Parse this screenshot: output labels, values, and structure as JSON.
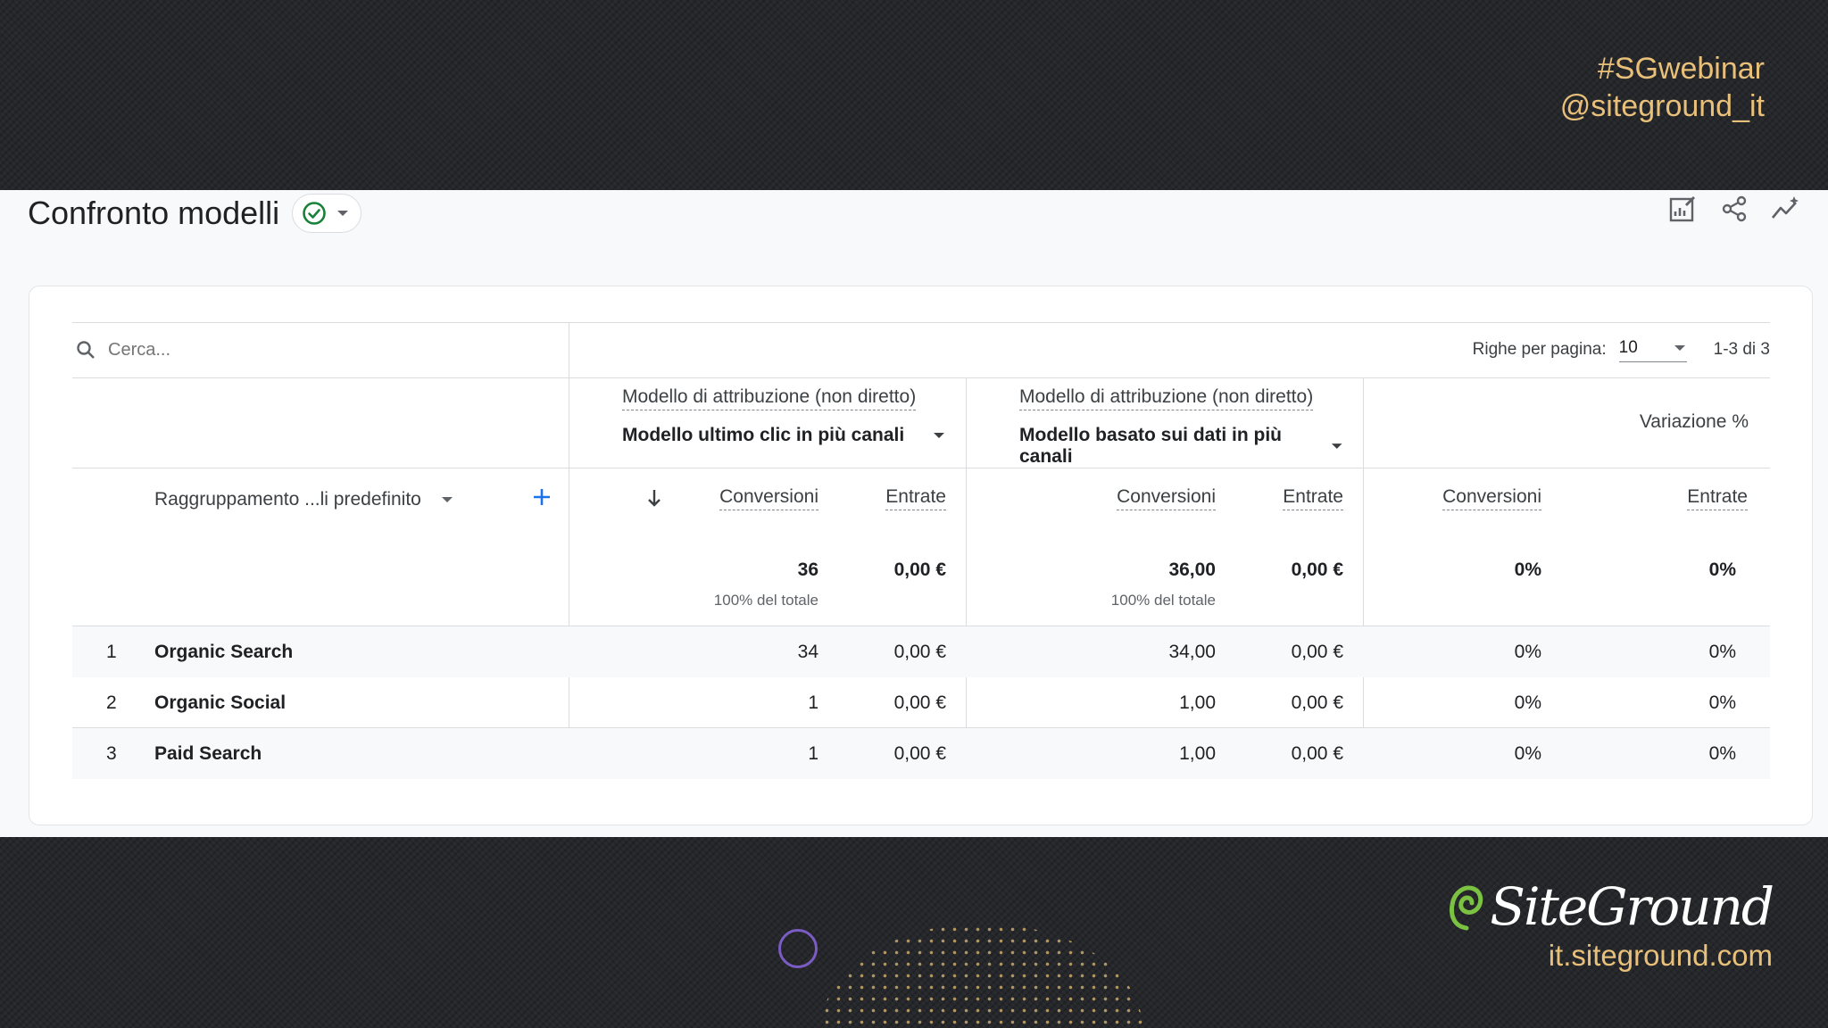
{
  "overlay": {
    "hashtag": "#SGwebinar",
    "handle": "@siteground_it",
    "brand_name": "SiteGround",
    "brand_url": "it.siteground.com"
  },
  "header": {
    "title": "Confronto modelli",
    "status_icon": "check-circle-icon",
    "actions": [
      "edit-report-icon",
      "share-icon",
      "insights-icon"
    ]
  },
  "table": {
    "search_placeholder": "Cerca...",
    "rows_per_page_label": "Righe per pagina:",
    "rows_per_page_value": "10",
    "range_label": "1-3 di 3",
    "model_caption_1": "Modello di attribuzione (non diretto)",
    "model_1": "Modello ultimo clic in più canali",
    "model_caption_2": "Modello di attribuzione (non diretto)",
    "model_2": "Modello basato sui dati in più canali",
    "variation_label": "Variazione %",
    "dimension_label": "Raggruppamento ...li predefinito",
    "metrics": {
      "m1_conv": "Conversioni",
      "m1_rev": "Entrate",
      "m2_conv": "Conversioni",
      "m2_rev": "Entrate",
      "var_conv": "Conversioni",
      "var_rev": "Entrate"
    },
    "totals": {
      "m1_conv": "36",
      "m1_conv_sub": "100% del totale",
      "m1_rev": "0,00 €",
      "m2_conv": "36,00",
      "m2_conv_sub": "100% del totale",
      "m2_rev": "0,00 €",
      "var_conv": "0%",
      "var_rev": "0%"
    },
    "rows": [
      {
        "idx": "1",
        "name": "Organic Search",
        "m1_conv": "34",
        "m1_rev": "0,00 €",
        "m2_conv": "34,00",
        "m2_rev": "0,00 €",
        "var_conv": "0%",
        "var_rev": "0%"
      },
      {
        "idx": "2",
        "name": "Organic Social",
        "m1_conv": "1",
        "m1_rev": "0,00 €",
        "m2_conv": "1,00",
        "m2_rev": "0,00 €",
        "var_conv": "0%",
        "var_rev": "0%"
      },
      {
        "idx": "3",
        "name": "Paid Search",
        "m1_conv": "1",
        "m1_rev": "0,00 €",
        "m2_conv": "1,00",
        "m2_rev": "0,00 €",
        "var_conv": "0%",
        "var_rev": "0%"
      }
    ]
  },
  "colors": {
    "accent_blue": "#1a73e8",
    "success_green": "#188038",
    "overlay_gold": "#e8c07a",
    "brand_green": "#7cc242"
  }
}
